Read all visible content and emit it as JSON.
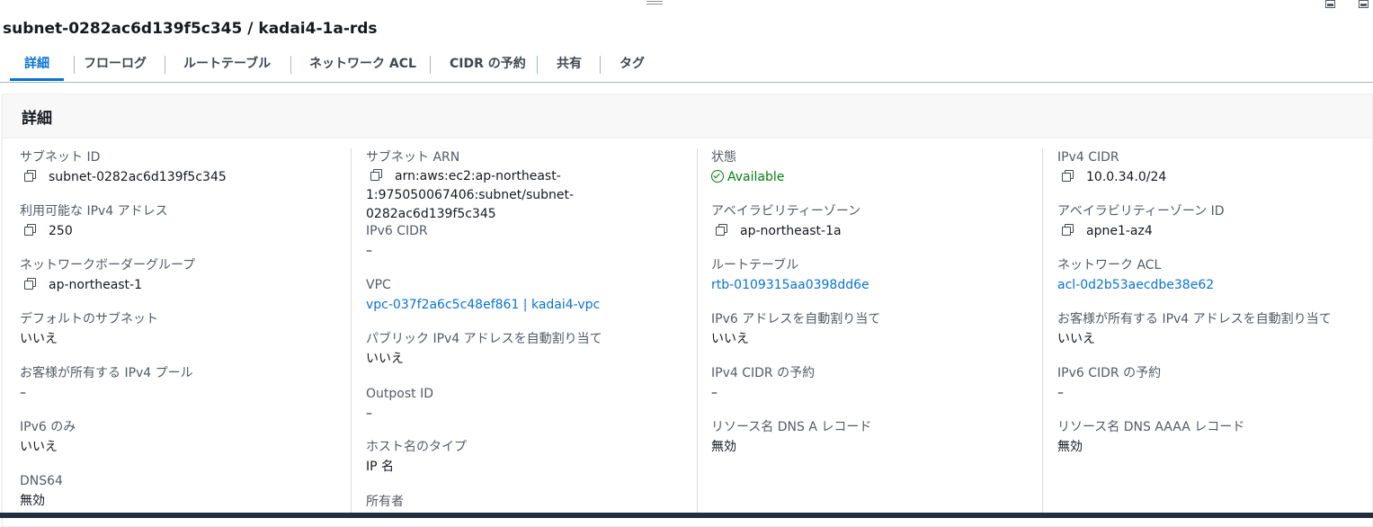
{
  "title": "subnet-0282ac6d139f5c345 / kadai4-1a-rds",
  "tabs": [
    "詳細",
    "フローログ",
    "ルートテーブル",
    "ネットワーク ACL",
    "CIDR の予約",
    "共有",
    "タグ"
  ],
  "panel_title": "詳細",
  "col1": [
    {
      "label": "サブネット ID",
      "value": "subnet-0282ac6d139f5c345"
    },
    {
      "label": "利用可能な IPv4 アドレス",
      "value": "250"
    },
    {
      "label": "ネットワークボーダーグループ",
      "value": "ap-northeast-1"
    },
    {
      "label": "デフォルトのサブネット",
      "value": "いいえ"
    },
    {
      "label": "お客様が所有する IPv4 プール",
      "value": "–"
    },
    {
      "label": "IPv6 のみ",
      "value": "いいえ"
    },
    {
      "label": "DNS64",
      "value": "無効"
    }
  ],
  "col2": [
    {
      "label": "サブネット ARN",
      "value_line1": "arn:aws:ec2:ap-northeast-",
      "value_line2": "1:975050067406:subnet/subnet-0282ac6d139f5c345"
    },
    {
      "label": "IPv6 CIDR",
      "value": "–"
    },
    {
      "label": "VPC",
      "value": "vpc-037f2a6c5c48ef861 | kadai4-vpc"
    },
    {
      "label": "パブリック IPv4 アドレスを自動割り当て",
      "value": "いいえ"
    },
    {
      "label": "Outpost ID",
      "value": "–"
    },
    {
      "label": "ホスト名のタイプ",
      "value": "IP 名"
    },
    {
      "label": "所有者",
      "value": ""
    }
  ],
  "col3": [
    {
      "label": "状態",
      "value": "Available"
    },
    {
      "label": "アベイラビリティーゾーン",
      "value": "ap-northeast-1a"
    },
    {
      "label": "ルートテーブル",
      "value": "rtb-0109315aa0398dd6e"
    },
    {
      "label": "IPv6 アドレスを自動割り当て",
      "value": "いいえ"
    },
    {
      "label": "IPv4 CIDR の予約",
      "value": "–"
    },
    {
      "label": "リソース名 DNS A レコード",
      "value": "無効"
    }
  ],
  "col4": [
    {
      "label": "IPv4 CIDR",
      "value": "10.0.34.0/24"
    },
    {
      "label": "アベイラビリティーゾーン ID",
      "value": "apne1-az4"
    },
    {
      "label": "ネットワーク ACL",
      "value": "acl-0d2b53aecdbe38e62"
    },
    {
      "label": "お客様が所有する IPv4 アドレスを自動割り当て",
      "value": "いいえ"
    },
    {
      "label": "IPv6 CIDR の予約",
      "value": "–"
    },
    {
      "label": "リソース名 DNS AAAA レコード",
      "value": "無効"
    }
  ],
  "colors": {
    "link": "#0972d3",
    "success": "#037f0c",
    "text": "#16191f",
    "label": "#545b64"
  },
  "icons": [
    "copy-icon",
    "status-available-icon",
    "drag-handle-icon",
    "window-control-icon"
  ]
}
